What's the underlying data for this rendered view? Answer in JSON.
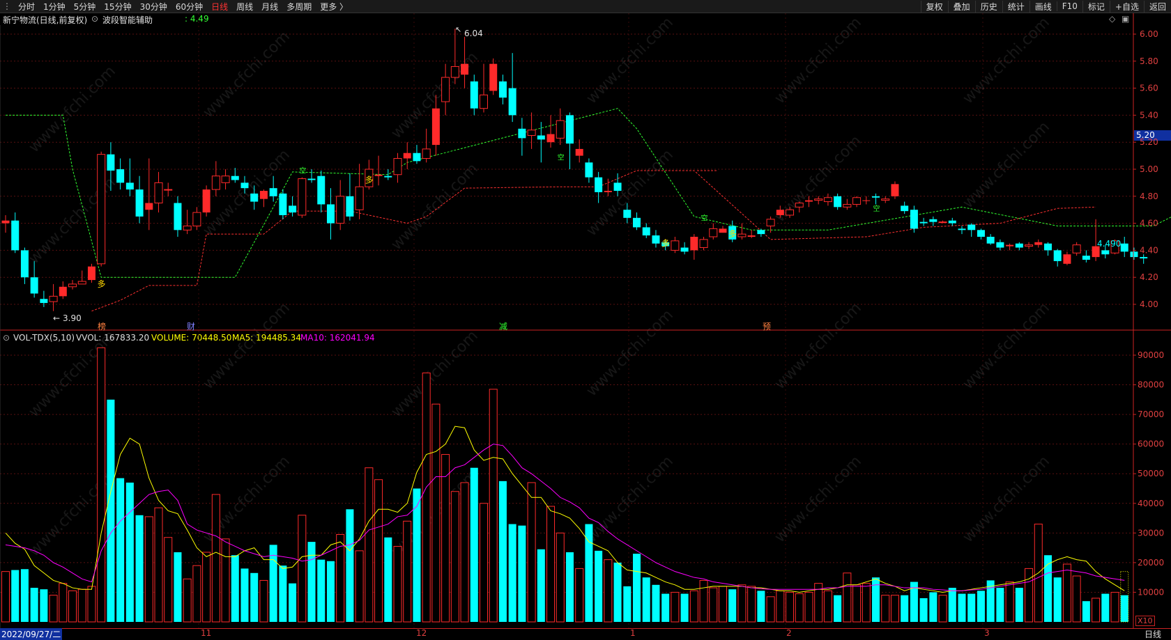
{
  "toolbar": {
    "periods": [
      "分时",
      "1分钟",
      "5分钟",
      "15分钟",
      "30分钟",
      "60分钟",
      "日线",
      "周线",
      "月线",
      "多周期",
      "更多 〉"
    ],
    "active_period": "日线",
    "actions": [
      "复权",
      "叠加",
      "历史",
      "统计",
      "画线",
      "F10",
      "标记",
      "+自选",
      "返回"
    ]
  },
  "header": {
    "stock_title": "新宁物流(日线,前复权)",
    "indicator_name": "波段智能辅助",
    "indicator_value": ": 4.49",
    "marker_icons": [
      "diamond-icon",
      "window-icon"
    ]
  },
  "volume_header": {
    "name": "VOL-TDX(5,10)",
    "vvol": "VVOL: 167833.20",
    "volume": "VOLUME: 70448.50",
    "ma5": "MA5: 194485.34",
    "ma10": "MA10: 162041.94"
  },
  "price_axis": {
    "ticks": [
      "6.00",
      "5.80",
      "5.60",
      "5.40",
      "5.20",
      "5.00",
      "4.80",
      "4.60",
      "4.40",
      "4.20",
      "4.00"
    ],
    "current_price_tag": "5.20"
  },
  "volume_axis": {
    "ticks": [
      "90000",
      "80000",
      "70000",
      "60000",
      "50000",
      "40000",
      "30000",
      "20000",
      "10000"
    ],
    "unit": "X10"
  },
  "date_axis": {
    "start": "2022/09/27/二",
    "months": [
      "11",
      "12",
      "1",
      "2",
      "3"
    ],
    "period_label": "日线"
  },
  "annotations": {
    "high_label": "6.04",
    "low_label": "3.90",
    "last_label": "4.490",
    "signal_duo": "多",
    "signal_kong": "空",
    "event_markers": [
      "榜",
      "财",
      "减",
      "预"
    ]
  },
  "watermark": "www.cfchi.com",
  "colors": {
    "up": "#ff2a2a",
    "down": "#00ffff",
    "ma5": "#ffff00",
    "ma10": "#ff00ff",
    "axis": "#cc2222",
    "support": "#ff3030",
    "resistance": "#30ff30"
  },
  "chart_data": {
    "type": "candlestick",
    "price_axis_range": [
      3.85,
      6.1
    ],
    "volume_axis_range": [
      0,
      97000
    ],
    "candles": [
      [
        4.6,
        4.62,
        4.66,
        4.53
      ],
      [
        4.62,
        4.4,
        4.68,
        4.38
      ],
      [
        4.4,
        4.2,
        4.42,
        4.15
      ],
      [
        4.2,
        4.08,
        4.32,
        4.05
      ],
      [
        4.04,
        4.01,
        4.1,
        3.98
      ],
      [
        4.02,
        4.06,
        4.15,
        3.95
      ],
      [
        4.06,
        4.13,
        4.17,
        4.04
      ],
      [
        4.13,
        4.15,
        4.18,
        4.11
      ],
      [
        4.15,
        4.17,
        4.25,
        4.15
      ],
      [
        4.18,
        4.28,
        4.3,
        4.16
      ],
      [
        4.3,
        5.11,
        5.13,
        4.28
      ],
      [
        5.11,
        4.99,
        5.2,
        4.84
      ],
      [
        5.0,
        4.9,
        5.08,
        4.85
      ],
      [
        4.9,
        4.85,
        5.08,
        4.8
      ],
      [
        4.85,
        4.65,
        4.95,
        4.6
      ],
      [
        4.7,
        4.75,
        5.08,
        4.55
      ],
      [
        4.75,
        4.9,
        4.98,
        4.68
      ],
      [
        4.85,
        4.85,
        4.9,
        4.8
      ],
      [
        4.75,
        4.55,
        4.8,
        4.5
      ],
      [
        4.55,
        4.58,
        4.7,
        4.52
      ],
      [
        4.58,
        4.68,
        4.72,
        4.55
      ],
      [
        4.68,
        4.85,
        4.88,
        4.65
      ],
      [
        4.85,
        4.95,
        5.06,
        4.8
      ],
      [
        4.9,
        4.95,
        5.0,
        4.85
      ],
      [
        4.95,
        4.92,
        5.01,
        4.9
      ],
      [
        4.9,
        4.86,
        4.95,
        4.82
      ],
      [
        4.82,
        4.76,
        4.88,
        4.7
      ],
      [
        4.78,
        4.84,
        4.85,
        4.72
      ],
      [
        4.86,
        4.8,
        4.95,
        4.76
      ],
      [
        4.82,
        4.66,
        4.85,
        4.63
      ],
      [
        4.73,
        4.68,
        4.8,
        4.65
      ],
      [
        4.66,
        4.93,
        4.94,
        4.64
      ],
      [
        4.93,
        4.92,
        5.0,
        4.9
      ],
      [
        4.95,
        4.74,
        4.99,
        4.68
      ],
      [
        4.74,
        4.6,
        4.86,
        4.48
      ],
      [
        4.6,
        4.8,
        4.92,
        4.55
      ],
      [
        4.8,
        4.65,
        4.97,
        4.62
      ],
      [
        4.7,
        4.87,
        5.04,
        4.63
      ],
      [
        4.87,
        5.0,
        5.07,
        4.85
      ],
      [
        4.95,
        4.96,
        5.1,
        4.88
      ],
      [
        4.95,
        4.94,
        5.0,
        4.92
      ],
      [
        4.96,
        5.08,
        5.12,
        4.9
      ],
      [
        5.08,
        5.12,
        5.2,
        5.0
      ],
      [
        5.12,
        5.06,
        5.18,
        5.04
      ],
      [
        5.08,
        5.15,
        5.3,
        5.05
      ],
      [
        5.18,
        5.45,
        5.55,
        5.1
      ],
      [
        5.5,
        5.68,
        5.78,
        5.4
      ],
      [
        5.68,
        5.76,
        6.04,
        5.63
      ],
      [
        5.7,
        5.78,
        5.98,
        5.6
      ],
      [
        5.65,
        5.45,
        5.7,
        5.4
      ],
      [
        5.45,
        5.55,
        5.78,
        5.42
      ],
      [
        5.58,
        5.78,
        5.82,
        5.55
      ],
      [
        5.65,
        5.53,
        5.7,
        5.48
      ],
      [
        5.6,
        5.4,
        5.86,
        5.35
      ],
      [
        5.3,
        5.23,
        5.38,
        5.1
      ],
      [
        5.25,
        5.29,
        5.42,
        5.15
      ],
      [
        5.25,
        5.22,
        5.35,
        5.05
      ],
      [
        5.2,
        5.26,
        5.4,
        5.16
      ],
      [
        5.23,
        5.36,
        5.45,
        5.18
      ],
      [
        5.4,
        5.19,
        5.42,
        5.0
      ],
      [
        5.1,
        5.15,
        5.22,
        5.05
      ],
      [
        5.05,
        4.94,
        5.08,
        4.9
      ],
      [
        4.94,
        4.83,
        4.98,
        4.75
      ],
      [
        4.83,
        4.84,
        4.93,
        4.8
      ],
      [
        4.9,
        4.84,
        4.97,
        4.8
      ],
      [
        4.7,
        4.64,
        4.75,
        4.6
      ],
      [
        4.64,
        4.57,
        4.68,
        4.55
      ],
      [
        4.57,
        4.51,
        4.6,
        4.49
      ],
      [
        4.51,
        4.45,
        4.55,
        4.42
      ],
      [
        4.46,
        4.43,
        4.48,
        4.4
      ],
      [
        4.4,
        4.47,
        4.5,
        4.38
      ],
      [
        4.42,
        4.39,
        4.46,
        4.37
      ],
      [
        4.4,
        4.5,
        4.52,
        4.33
      ],
      [
        4.42,
        4.48,
        4.5,
        4.4
      ],
      [
        4.5,
        4.56,
        4.6,
        4.48
      ],
      [
        4.53,
        4.56,
        4.58,
        4.53
      ],
      [
        4.58,
        4.48,
        4.62,
        4.46
      ],
      [
        4.5,
        4.52,
        4.6,
        4.48
      ],
      [
        4.5,
        4.51,
        4.55,
        4.49
      ],
      [
        4.55,
        4.52,
        4.56,
        4.5
      ],
      [
        4.58,
        4.63,
        4.65,
        4.53
      ],
      [
        4.66,
        4.7,
        4.73,
        4.64
      ],
      [
        4.66,
        4.7,
        4.72,
        4.64
      ],
      [
        4.72,
        4.75,
        4.76,
        4.68
      ],
      [
        4.76,
        4.77,
        4.8,
        4.72
      ],
      [
        4.77,
        4.78,
        4.8,
        4.74
      ],
      [
        4.76,
        4.79,
        4.82,
        4.73
      ],
      [
        4.8,
        4.72,
        4.82,
        4.7
      ],
      [
        4.72,
        4.74,
        4.78,
        4.7
      ],
      [
        4.74,
        4.79,
        4.8,
        4.72
      ],
      [
        4.77,
        4.77,
        4.8,
        4.74
      ],
      [
        4.8,
        4.79,
        4.82,
        4.74
      ],
      [
        4.77,
        4.78,
        4.8,
        4.75
      ],
      [
        4.8,
        4.89,
        4.91,
        4.78
      ],
      [
        4.73,
        4.69,
        4.76,
        4.67
      ],
      [
        4.7,
        4.56,
        4.73,
        4.53
      ],
      [
        4.61,
        4.6,
        4.64,
        4.58
      ],
      [
        4.63,
        4.61,
        4.65,
        4.58
      ],
      [
        4.61,
        4.61,
        4.62,
        4.6
      ],
      [
        4.62,
        4.6,
        4.64,
        4.58
      ],
      [
        4.56,
        4.55,
        4.58,
        4.52
      ],
      [
        4.59,
        4.55,
        4.6,
        4.5
      ],
      [
        4.55,
        4.5,
        4.56,
        4.48
      ],
      [
        4.5,
        4.45,
        4.52,
        4.44
      ],
      [
        4.46,
        4.42,
        4.48,
        4.4
      ],
      [
        4.43,
        4.44,
        4.45,
        4.4
      ],
      [
        4.45,
        4.42,
        4.46,
        4.4
      ],
      [
        4.43,
        4.44,
        4.46,
        4.41
      ],
      [
        4.44,
        4.46,
        4.48,
        4.42
      ],
      [
        4.45,
        4.4,
        4.46,
        4.36
      ],
      [
        4.4,
        4.32,
        4.41,
        4.28
      ],
      [
        4.3,
        4.37,
        4.39,
        4.29
      ],
      [
        4.38,
        4.44,
        4.46,
        4.36
      ],
      [
        4.36,
        4.33,
        4.4,
        4.31
      ],
      [
        4.35,
        4.43,
        4.63,
        4.32
      ],
      [
        4.4,
        4.37,
        4.44,
        4.34
      ],
      [
        4.38,
        4.47,
        4.48,
        4.37
      ],
      [
        4.45,
        4.39,
        4.5,
        4.35
      ],
      [
        4.39,
        4.35,
        4.42,
        4.33
      ],
      [
        4.35,
        4.34,
        4.37,
        4.3
      ]
    ],
    "volumes": [
      17000,
      17500,
      17800,
      11500,
      11000,
      9000,
      13000,
      10500,
      11000,
      12000,
      92500,
      75000,
      48500,
      47000,
      36000,
      35500,
      38500,
      28500,
      23500,
      14500,
      19000,
      23500,
      43000,
      28000,
      22500,
      18000,
      16500,
      14000,
      26000,
      19000,
      13000,
      36000,
      27000,
      21000,
      20500,
      29500,
      38000,
      24000,
      52000,
      48000,
      28500,
      25500,
      34000,
      45000,
      84000,
      73500,
      56500,
      44000,
      47000,
      52000,
      40000,
      78500,
      47500,
      33000,
      32500,
      47000,
      24500,
      39000,
      30000,
      23500,
      18000,
      33000,
      24000,
      21000,
      20000,
      12000,
      23000,
      15000,
      12500,
      9500,
      10000,
      9500,
      10500,
      14000,
      11500,
      12000,
      11000,
      12500,
      12000,
      10500,
      8500,
      10500,
      10000,
      9500,
      10000,
      13000,
      10500,
      9000,
      16500,
      12500,
      13000,
      15000,
      9000,
      9000,
      9000,
      13500,
      8000,
      10000,
      9000,
      11500,
      9500,
      9500,
      10500,
      14000,
      11500,
      13500,
      11500,
      18000,
      33000,
      22500,
      15000,
      19500,
      15500,
      7000,
      8000,
      9500,
      10000,
      9000
    ],
    "ma5": [
      30000,
      26500,
      24500,
      19000,
      16500,
      14000,
      13000,
      11500,
      11000,
      11000,
      30000,
      44000,
      56500,
      62000,
      60000,
      48500,
      41000,
      37500,
      36500,
      31000,
      25000,
      22000,
      23500,
      22000,
      22000,
      24000,
      25000,
      21000,
      21000,
      18000,
      18500,
      22000,
      22500,
      22500,
      26000,
      27000,
      24000,
      28000,
      34000,
      38000,
      38000,
      37000,
      40000,
      50500,
      56500,
      57500,
      60000,
      66000,
      65500,
      58000,
      54500,
      55500,
      55000,
      50000,
      46000,
      42000,
      42000,
      37500,
      36500,
      35000,
      31500,
      27000,
      25500,
      24000,
      20000,
      17500,
      17000,
      16500,
      15000,
      13500,
      12500,
      11000,
      11000,
      11500,
      12000,
      12000,
      12000,
      12000,
      11500,
      11500,
      11000,
      10500,
      10500,
      10000,
      10500,
      11000,
      11000,
      11500,
      12500,
      12500,
      13500,
      14500,
      13000,
      12000,
      10500,
      11500,
      11000,
      10500,
      10000,
      10500,
      10500,
      11000,
      11500,
      12000,
      12500,
      13000,
      13500,
      14500,
      16500,
      19500,
      21000,
      22000,
      21000,
      20500,
      17000,
      14500,
      12500,
      10500
    ],
    "ma10": [
      26000,
      25500,
      25000,
      24000,
      22500,
      20000,
      18500,
      16500,
      14500,
      13500,
      24000,
      30000,
      34000,
      37000,
      40000,
      43000,
      44000,
      44500,
      41000,
      33000,
      31000,
      30000,
      29000,
      27000,
      25500,
      24000,
      23000,
      22000,
      22500,
      22000,
      21500,
      20500,
      21000,
      22500,
      24000,
      25500,
      26000,
      27500,
      31000,
      32000,
      33000,
      35500,
      36000,
      39000,
      45500,
      49000,
      49000,
      52000,
      53000,
      55500,
      58000,
      60000,
      59500,
      56000,
      52000,
      50000,
      47500,
      45000,
      42000,
      40500,
      38500,
      35000,
      33500,
      30500,
      28000,
      26000,
      24000,
      22000,
      20000,
      18500,
      17000,
      16000,
      15000,
      14500,
      13500,
      13000,
      12500,
      12000,
      11500,
      11200,
      11000,
      11000,
      11000,
      11000,
      11000,
      11000,
      11500,
      11500,
      12000,
      12000,
      12000,
      12500,
      12500,
      12000,
      11500,
      11500,
      11500,
      11000,
      10800,
      10500,
      10500,
      10800,
      11000,
      11500,
      12000,
      12500,
      13000,
      13500,
      15000,
      16500,
      17000,
      17500,
      17000,
      16500,
      15500,
      15000,
      14500,
      14000
    ],
    "resistance_line": [
      [
        0,
        5.4
      ],
      [
        6,
        5.4
      ],
      [
        7,
        5.0
      ],
      [
        10,
        4.2
      ],
      [
        13,
        4.2
      ],
      [
        24,
        4.2
      ],
      [
        30,
        4.98
      ],
      [
        40,
        4.96
      ],
      [
        42,
        5.05
      ],
      [
        64,
        5.45
      ],
      [
        66,
        5.3
      ],
      [
        72,
        4.65
      ],
      [
        78,
        4.55
      ],
      [
        86,
        4.55
      ],
      [
        100,
        4.72
      ],
      [
        110,
        4.58
      ],
      [
        120,
        4.58
      ],
      [
        122,
        4.65
      ],
      [
        130,
        4.48
      ],
      [
        136,
        4.52
      ]
    ],
    "support_line": [
      [
        9,
        3.95
      ],
      [
        12,
        4.03
      ],
      [
        15,
        4.14
      ],
      [
        20,
        4.14
      ],
      [
        21,
        4.52
      ],
      [
        27,
        4.52
      ],
      [
        30,
        4.69
      ],
      [
        36,
        4.69
      ],
      [
        42,
        4.6
      ],
      [
        44,
        4.65
      ],
      [
        48,
        4.86
      ],
      [
        58,
        4.87
      ],
      [
        62,
        4.87
      ],
      [
        66,
        4.99
      ],
      [
        72,
        4.99
      ],
      [
        80,
        4.48
      ],
      [
        90,
        4.5
      ],
      [
        96,
        4.57
      ],
      [
        104,
        4.6
      ],
      [
        110,
        4.71
      ],
      [
        114,
        4.72
      ]
    ]
  }
}
